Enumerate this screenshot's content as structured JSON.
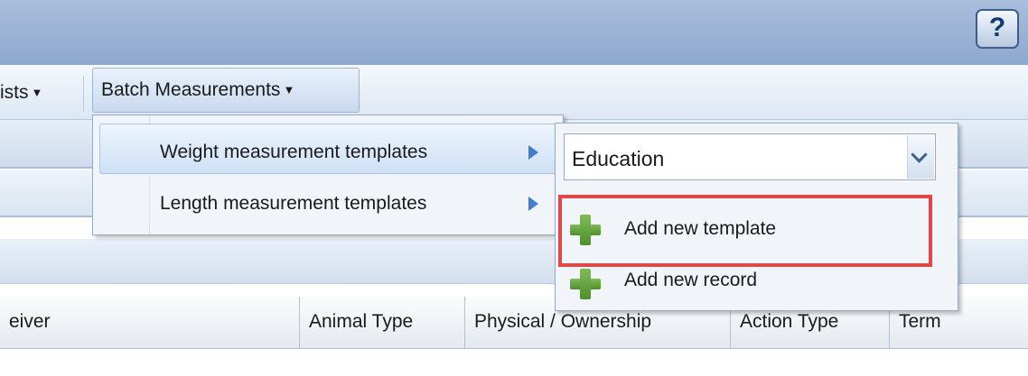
{
  "help_button": {
    "label": "?"
  },
  "menubar": {
    "lists_label": "ists",
    "batch_label": "Batch Measurements"
  },
  "batch_menu": {
    "items": [
      {
        "label": "Weight measurement templates",
        "has_submenu": true,
        "highlighted": true
      },
      {
        "label": "Length measurement templates",
        "has_submenu": true,
        "highlighted": false
      }
    ]
  },
  "submenu": {
    "select_value": "Education",
    "actions": [
      {
        "label": "Add new template",
        "icon": "plus-icon",
        "outlined": true
      },
      {
        "label": "Add new record",
        "icon": "plus-icon",
        "outlined": false
      }
    ],
    "highlight_color": "#e04848"
  },
  "grid": {
    "columns": [
      "eiver",
      "Animal Type",
      "Physical / Ownership",
      "Action Type",
      "Term"
    ]
  },
  "colors": {
    "chrome": "#a9bedb",
    "accent_arrow": "#3f7fd1",
    "plus_green": "#5f9e36"
  }
}
